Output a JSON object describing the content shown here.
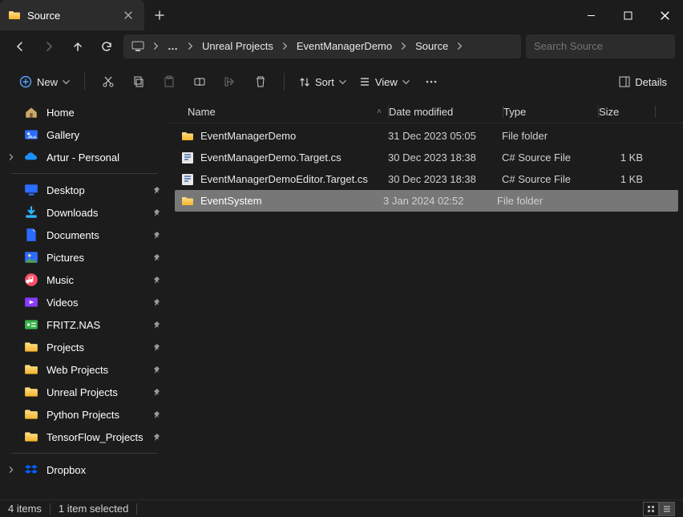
{
  "tab": {
    "title": "Source"
  },
  "breadcrumb": [
    "Unreal Projects",
    "EventManagerDemo",
    "Source"
  ],
  "search": {
    "placeholder": "Search Source"
  },
  "toolbar": {
    "new": "New",
    "sort": "Sort",
    "view": "View",
    "details": "Details"
  },
  "columns": {
    "name": "Name",
    "date": "Date modified",
    "type": "Type",
    "size": "Size"
  },
  "sidebar_top": [
    {
      "label": "Home",
      "icon": "home"
    },
    {
      "label": "Gallery",
      "icon": "gallery"
    },
    {
      "label": "Artur - Personal",
      "icon": "onedrive",
      "expandable": true
    }
  ],
  "sidebar_quick": [
    {
      "label": "Desktop",
      "icon": "desktop"
    },
    {
      "label": "Downloads",
      "icon": "downloads"
    },
    {
      "label": "Documents",
      "icon": "documents"
    },
    {
      "label": "Pictures",
      "icon": "pictures"
    },
    {
      "label": "Music",
      "icon": "music"
    },
    {
      "label": "Videos",
      "icon": "videos"
    },
    {
      "label": "FRITZ.NAS",
      "icon": "nas"
    },
    {
      "label": "Projects",
      "icon": "folder"
    },
    {
      "label": "Web Projects",
      "icon": "folder"
    },
    {
      "label": "Unreal Projects",
      "icon": "folder"
    },
    {
      "label": "Python Projects",
      "icon": "folder"
    },
    {
      "label": "TensorFlow_Projects",
      "icon": "folder"
    }
  ],
  "sidebar_bottom": [
    {
      "label": "Dropbox",
      "icon": "dropbox",
      "expandable": true
    }
  ],
  "files": [
    {
      "name": "EventManagerDemo",
      "type": "File folder",
      "date": "31 Dec 2023 05:05",
      "size": "",
      "icon": "folder",
      "selected": false
    },
    {
      "name": "EventManagerDemo.Target.cs",
      "type": "C# Source File",
      "date": "30 Dec 2023 18:38",
      "size": "1 KB",
      "icon": "cs",
      "selected": false
    },
    {
      "name": "EventManagerDemoEditor.Target.cs",
      "type": "C# Source File",
      "date": "30 Dec 2023 18:38",
      "size": "1 KB",
      "icon": "cs",
      "selected": false
    },
    {
      "name": "EventSystem",
      "type": "File folder",
      "date": "3 Jan 2024 02:52",
      "size": "",
      "icon": "folder",
      "selected": true
    }
  ],
  "status": {
    "count": "4 items",
    "selection": "1 item selected"
  }
}
